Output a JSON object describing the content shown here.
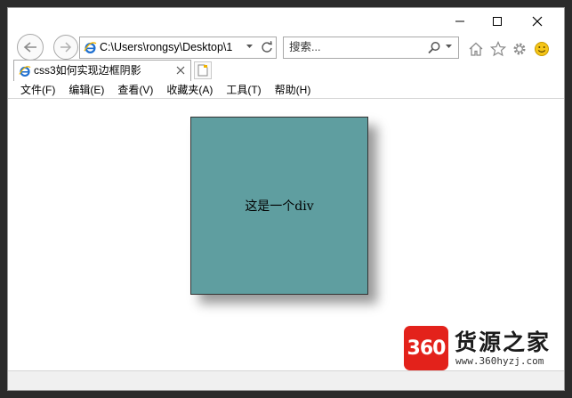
{
  "address_bar": {
    "url": "C:\\Users\\rongsy\\Desktop\\1"
  },
  "search_box": {
    "placeholder": "搜索..."
  },
  "tab": {
    "title": "css3如何实现边框阴影"
  },
  "menu": {
    "items": [
      "文件(F)",
      "编辑(E)",
      "查看(V)",
      "收藏夹(A)",
      "工具(T)",
      "帮助(H)"
    ]
  },
  "page": {
    "box_text": "这是一个div",
    "box_color": "#5f9ea0"
  },
  "watermark": {
    "logo_text": "360",
    "name": "货源之家",
    "url": "www.360hyzj.com"
  },
  "colors": {
    "ie_blue": "#1e6fd0",
    "logo_red": "#e3221b",
    "smiley_yellow": "#f5c518"
  }
}
